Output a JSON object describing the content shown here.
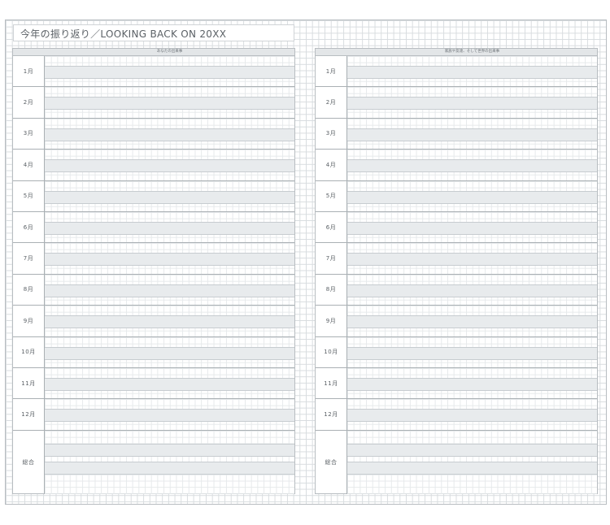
{
  "title": "今年の振り返り／LOOKING BACK ON 20XX",
  "left_page": {
    "header": "あなたの出来事"
  },
  "right_page": {
    "header": "家族や友達、そして世界の出来事"
  },
  "rows": [
    "1月",
    "2月",
    "3月",
    "4月",
    "5月",
    "6月",
    "7月",
    "8月",
    "9月",
    "10月",
    "11月",
    "12月",
    "総合"
  ]
}
